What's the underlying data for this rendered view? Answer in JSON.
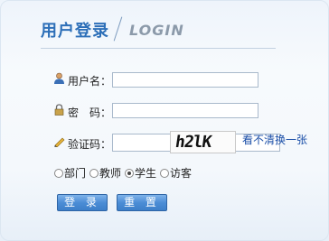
{
  "header": {
    "title": "用户登录",
    "subtitle": "LOGIN"
  },
  "form": {
    "username_label": "用户名：",
    "password_label": "密　码：",
    "captcha_label": "验证码：",
    "username_value": "",
    "password_value": "",
    "captcha_value": "",
    "captcha_image_text": "h2lK",
    "refresh_link": "看不清换一张"
  },
  "roles": {
    "options": [
      "部门",
      "教师",
      "学生",
      "访客"
    ],
    "selected": "学生"
  },
  "buttons": {
    "login": "登 录",
    "reset": "重 置"
  },
  "colors": {
    "accent": "#2d6fb8",
    "button": "#4b8dd6"
  },
  "icons": {
    "username": "user-icon",
    "password": "lock-icon",
    "captcha": "pencil-icon"
  }
}
